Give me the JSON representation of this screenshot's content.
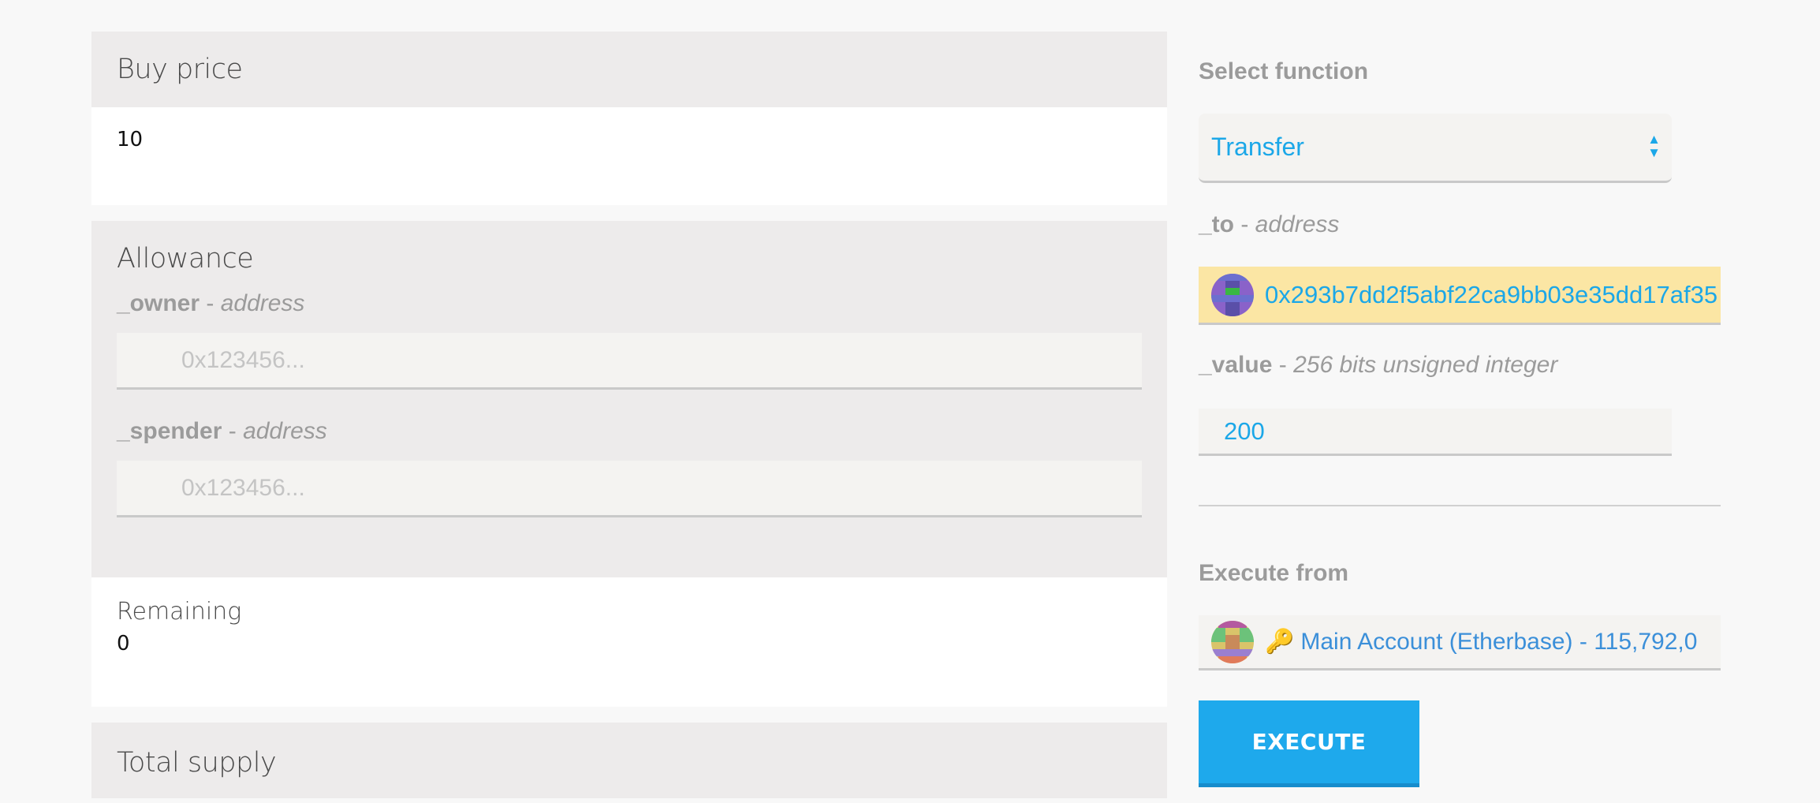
{
  "left": {
    "buy_price": {
      "title": "Buy price",
      "value": "10"
    },
    "allowance": {
      "title": "Allowance",
      "owner": {
        "name": "_owner",
        "sep": " - ",
        "type": "address",
        "placeholder": "0x123456..."
      },
      "spender": {
        "name": "_spender",
        "sep": " - ",
        "type": "address",
        "placeholder": "0x123456..."
      },
      "remaining_label": "Remaining",
      "remaining_value": "0"
    },
    "total_supply": {
      "title": "Total supply"
    }
  },
  "right": {
    "select_function_label": "Select function",
    "selected_function": "Transfer",
    "to": {
      "name": "_to",
      "sep": " - ",
      "type": "address",
      "value": "0x293b7dd2f5abf22ca9bb03e35dd17af35"
    },
    "value": {
      "name": "_value",
      "sep": " - ",
      "type": "256 bits unsigned integer",
      "value": "200"
    },
    "execute_from_label": "Execute from",
    "account": "Main Account (Etherbase) - 115,792,0",
    "execute_button": "EXECUTE"
  },
  "colors": {
    "accent": "#1ba7e8",
    "button": "#1ea9ec",
    "highlight": "#fbe6a4"
  },
  "icons": {
    "select_arrows": "updown-arrows-icon",
    "account_key": "key-icon"
  }
}
